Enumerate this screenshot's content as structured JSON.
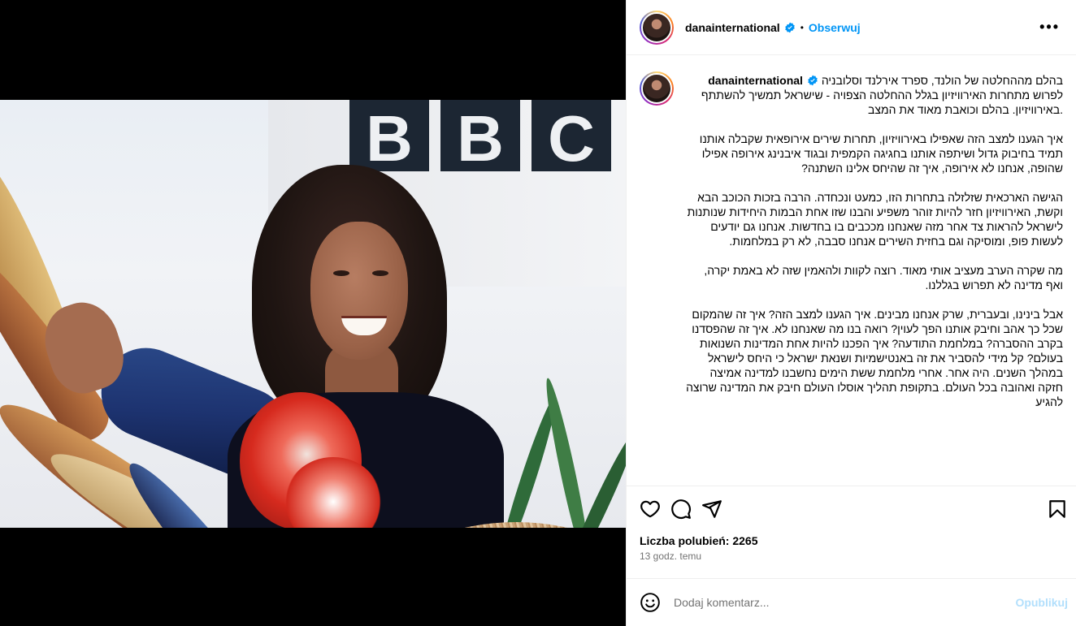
{
  "header": {
    "username": "danainternational",
    "separator": "•",
    "follow_label": "Obserwuj",
    "more_label": "•••"
  },
  "caption": {
    "username": "danainternational",
    "paragraphs": [
      "בהלם מההחלטה של הולנד, ספרד אירלנד וסלובניה לפרוש מתחרות האירוויזיון בגלל ההחלטה הצפויה - שישראל תמשיך להשתתף באירוויזיון. בהלם וכואבת מאוד את המצב.",
      "איך הגענו למצב הזה שאפילו באירוויזיון, תחרות שירים אירופאית שקבלה אותנו תמיד בחיבוק גדול ושיתפה אותנו בחגיגה הקמפית ובגוד איבנינג אירופה אפילו שהופה, אנחנו לא אירופה, איך זה שהיחס אלינו השתנה?",
      "הגישה הארכאית שזלזלה בתחרות הזו, כמעט ונכחדה. הרבה בזכות הכוכב הבא וקשת, האירוויזיון חזר להיות זוהר משפיע והבנו שזו אחת הבמות היחידות שנותנות לישראל להראות צד אחר מזה שאנחנו מככבים בו בחדשות. אנחנו גם יודעים לעשות פופ, ומוסיקה וגם בחזית השירים אנחנו סבבה, לא רק במלחמות.",
      "מה שקרה הערב מעציב אותי מאוד. רוצה לקוות ולהאמין שזה לא באמת יקרה, ואף מדינה לא תפרוש בגללנו.",
      "אבל בינינו, ובעברית, שרק אנחנו מבינים. איך הגענו למצב הזה? איך זה שהמקום שכל כך אהב וחיבק אותנו הפך לעוין? רואה בנו מה שאנחנו לא. איך זה שהפסדנו בקרב ההסברה? במלחמת התודעה? איך הפכנו להיות אחת המדינות השנואות בעולם? קל מידי להסביר את זה באנטישמיות ושנאת ישראל כי היחס לישראל במהלך השנים. היה אחר. אחרי מלחמת ששת הימים נחשבנו למדינה אמיצה חזקה ואהובה בכל העולם. בתקופת תהליך אוסלו העולם חיבק את המדינה שרוצה להגיע"
    ]
  },
  "photo": {
    "sign_letters": [
      "B",
      "B",
      "C"
    ]
  },
  "actions": {
    "like_icon": "heart-icon",
    "comment_icon": "comment-icon",
    "share_icon": "share-icon",
    "save_icon": "bookmark-icon"
  },
  "likes_text": "Liczba polubień: 2265",
  "time_text": "13 godz. temu",
  "comment": {
    "placeholder": "Dodaj komentarz...",
    "publish_label": "Opublikuj",
    "emoji_icon": "emoji-icon"
  },
  "colors": {
    "accent": "#0095f6",
    "publish_disabled": "#b2dffc",
    "muted": "#737373"
  }
}
